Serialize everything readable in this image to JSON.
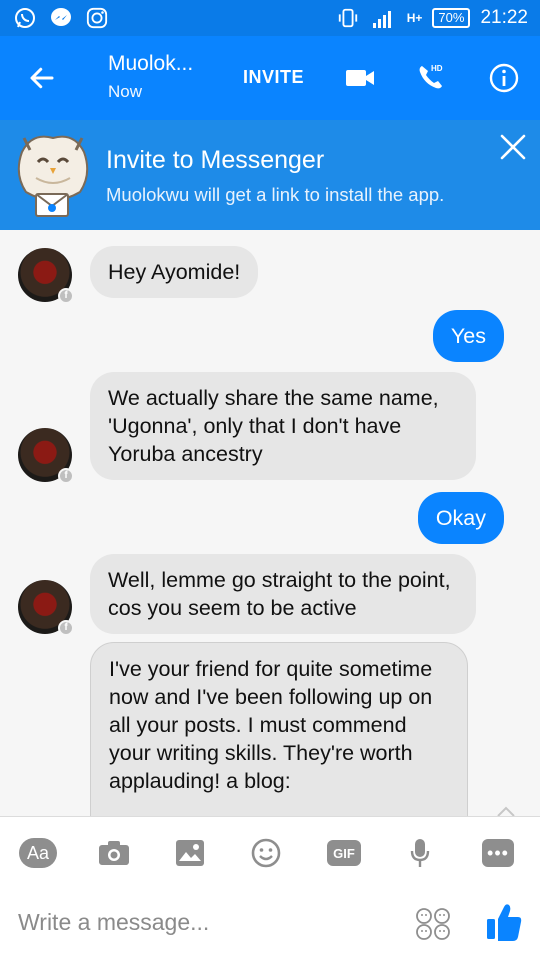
{
  "status_bar": {
    "network_label": "H+",
    "battery": "70%",
    "time": "21:22"
  },
  "header": {
    "contact_name": "Muolok...",
    "presence": "Now",
    "invite_label": "INVITE",
    "hd_label": "HD"
  },
  "banner": {
    "title": "Invite to Messenger",
    "subtitle": "Muolokwu will get a link to install the app."
  },
  "messages": [
    {
      "from": "contact",
      "text": "Hey Ayomide!"
    },
    {
      "from": "me",
      "text": "Yes"
    },
    {
      "from": "contact",
      "text": "We actually share the same name, 'Ugonna', only that I don't have Yoruba ancestry"
    },
    {
      "from": "me",
      "text": "Okay"
    },
    {
      "from": "contact",
      "text": "Well, lemme go straight to the point, cos you seem to be active"
    },
    {
      "from": "contact",
      "text": "I've your friend for quite sometime now and I've been following up on all your posts. I must commend your writing skills. They're worth applauding! a blog:"
    }
  ],
  "composer": {
    "aa_label": "Aa",
    "gif_label": "GIF",
    "more_label": "•••",
    "placeholder": "Write a message..."
  },
  "colors": {
    "brand": "#0a84ff",
    "statusbar": "#0a7be8",
    "banner": "#1e8be8",
    "incoming_bubble": "#e6e6e6"
  }
}
